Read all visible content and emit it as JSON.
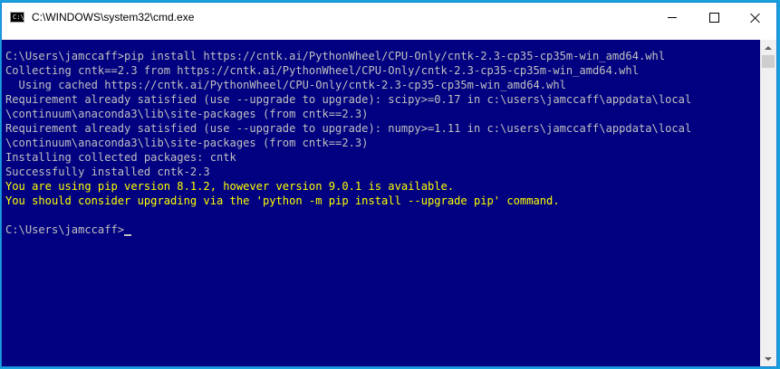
{
  "window": {
    "title": "C:\\WINDOWS\\system32\\cmd.exe",
    "icon": "console-icon",
    "icon_text": "C:\\",
    "controls": [
      "minimize-icon",
      "maximize-icon",
      "close-icon"
    ]
  },
  "colors": {
    "console_background": "#000080",
    "console_text": "#c0c0c0",
    "warning_text": "#ffff00",
    "desktop_background": "#17a0dc"
  },
  "console": {
    "lines": [
      {
        "text": "C:\\Users\\jamccaff>pip install https://cntk.ai/PythonWheel/CPU-Only/cntk-2.3-cp35-cp35m-win_amd64.whl",
        "kind": "normal"
      },
      {
        "text": "Collecting cntk==2.3 from https://cntk.ai/PythonWheel/CPU-Only/cntk-2.3-cp35-cp35m-win_amd64.whl",
        "kind": "normal"
      },
      {
        "text": "  Using cached https://cntk.ai/PythonWheel/CPU-Only/cntk-2.3-cp35-cp35m-win_amd64.whl",
        "kind": "normal"
      },
      {
        "text": "Requirement already satisfied (use --upgrade to upgrade): scipy>=0.17 in c:\\users\\jamccaff\\appdata\\local",
        "kind": "normal"
      },
      {
        "text": "\\continuum\\anaconda3\\lib\\site-packages (from cntk==2.3)",
        "kind": "normal"
      },
      {
        "text": "Requirement already satisfied (use --upgrade to upgrade): numpy>=1.11 in c:\\users\\jamccaff\\appdata\\local",
        "kind": "normal"
      },
      {
        "text": "\\continuum\\anaconda3\\lib\\site-packages (from cntk==2.3)",
        "kind": "normal"
      },
      {
        "text": "Installing collected packages: cntk",
        "kind": "normal"
      },
      {
        "text": "Successfully installed cntk-2.3",
        "kind": "normal"
      },
      {
        "text": "You are using pip version 8.1.2, however version 9.0.1 is available.",
        "kind": "warn"
      },
      {
        "text": "You should consider upgrading via the 'python -m pip install --upgrade pip' command.",
        "kind": "warn"
      },
      {
        "text": "",
        "kind": "normal"
      }
    ],
    "prompt": "C:\\Users\\jamccaff>"
  }
}
